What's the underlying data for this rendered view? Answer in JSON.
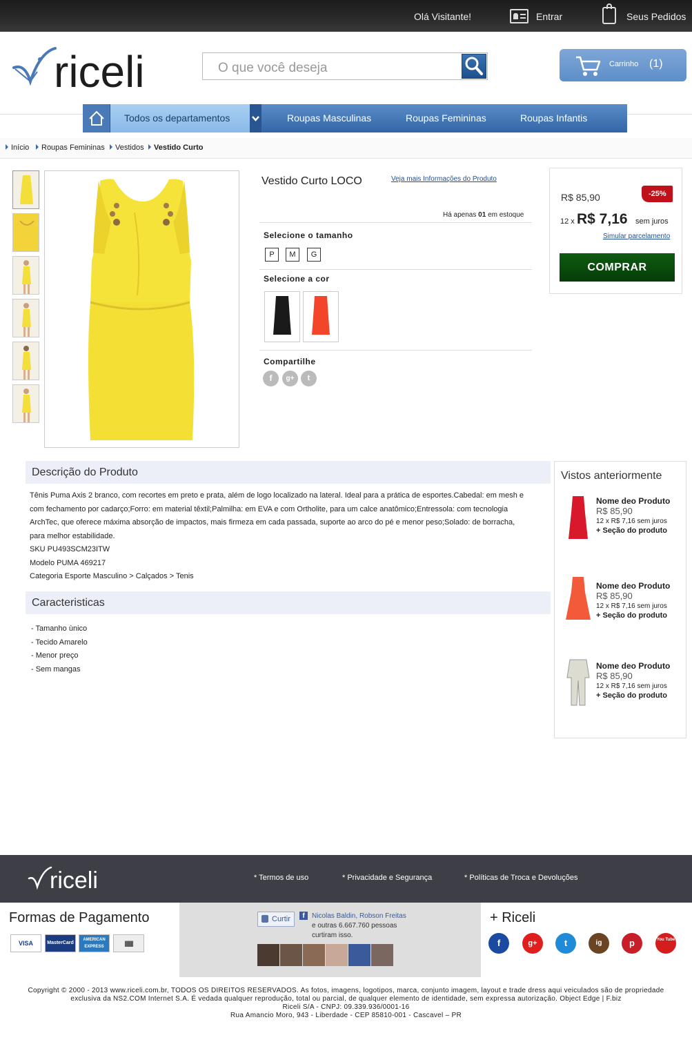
{
  "topbar": {
    "greeting": "Olá Visitante!",
    "login": "Entrar",
    "orders": "Seus Pedidos"
  },
  "header": {
    "logo": "riceli",
    "search_placeholder": "O que você deseja",
    "cart_label": "Carrinho",
    "cart_count": "(1)"
  },
  "nav": {
    "all_departments": "Todos os departamentos",
    "items": [
      "Roupas Masculinas",
      "Roupas Femininas",
      "Roupas Infantis"
    ]
  },
  "breadcrumb": [
    "Início",
    "Roupas Femininas",
    "Vestidos",
    "Vestido Curto"
  ],
  "product": {
    "title": "Vestido Curto LOCO",
    "more_info_link": "Veja mais Informações do Produto",
    "stock_prefix": "Há apenas",
    "stock_count": "01",
    "stock_suffix": "em estoque",
    "size_label": "Selecione o tamanho",
    "sizes": [
      "P",
      "M",
      "G"
    ],
    "color_label": "Selecione a cor",
    "colors": [
      "#1a1a1a",
      "#f2452a"
    ],
    "share_label": "Compartilhe",
    "share_icons": [
      "f",
      "g+",
      "t"
    ]
  },
  "pricing": {
    "old_price": "R$ 85,90",
    "discount": "-25%",
    "installments_count": "12 x",
    "installment_value": "R$ 7,16",
    "no_interest": "sem juros",
    "simulate_link": "Simular parcelamento",
    "buy_button": "COMPRAR"
  },
  "description": {
    "title": "Descrição do Produto",
    "lines": [
      "Tênis Puma Axis 2 branco, com recortes em preto e prata, além de logo localizado na lateral. Ideal para a prática de esportes.Cabedal: em mesh e",
      "com fechamento por cadarço;Forro: em material têxtil;Palmilha: em EVA e com Ortholite, para um calce anatômico;Entressola: com tecnologia",
      "ArchTec, que oferece máxima absorção de impactos, mais firmeza em cada passada, suporte ao arco do pé e menor peso;Solado: de borracha,",
      "para melhor estabilidade.",
      "SKU PU493SCM23ITW",
      "Modelo PUMA 469217",
      "Categoria Esporte Masculino > Calçados > Tenis"
    ]
  },
  "features": {
    "title": "Caracteristicas",
    "items": [
      "- Tamanho ùnico",
      "- Tecido Amarelo",
      "- Menor preço",
      "- Sem mangas"
    ]
  },
  "recently_viewed": {
    "title": "Vistos anteriormente",
    "items": [
      {
        "name": "Nome deo Produto",
        "price": "R$ 85,90",
        "installments": "12 x R$ 7,16 sem juros",
        "section": "+ Seção do produto",
        "color": "#d8192b"
      },
      {
        "name": "Nome deo Produto",
        "price": "R$ 85,90",
        "installments": "12 x R$ 7,16 sem juros",
        "section": "+ Seção do produto",
        "color": "#f25a3a"
      },
      {
        "name": "Nome deo Produto",
        "price": "R$ 85,90",
        "installments": "12 x R$ 7,16 sem juros",
        "section": "+ Seção do produto",
        "color": "#dcdcd0"
      }
    ]
  },
  "footer": {
    "logo": "riceli",
    "links": [
      "* Termos de uso",
      "* Privacidade e Segurança",
      "* Políticas de Troca e Devoluções"
    ],
    "payment_title": "Formas de Pagamento",
    "cards": [
      "VISA",
      "MasterCard",
      "AMERICAN EXPRESS",
      "||||||||"
    ],
    "facebook": {
      "like_button": "Curtir",
      "friend1": "Nicolas Baldin",
      "separator": ", ",
      "friend2": "Robson Freitas",
      "others": "e outras 6.667.760 pessoas",
      "liked": "curtiram isso."
    },
    "social_title": "+ Riceli",
    "social_icons": [
      "f",
      "g+",
      "t",
      "ig",
      "p",
      "You Tube"
    ],
    "copyright": [
      "Copyright © 2000 - 2013 www.riceli.com.br, TODOS OS DIREITOS RESERVADOS. As fotos, imagens, logotipos, marca, conjunto imagem, layout e trade dress aqui veiculados são de propriedade",
      "exclusiva da NS2.COM Internet S.A. É vedada qualquer reprodução, total ou parcial, de qualquer elemento de identidade, sem expressa autorização. Object Edge | F.biz",
      "Riceli S/A - CNPJ: 09.339.936/0001-16",
      "Rua Amancio Moro, 943 - Liberdade - CEP 85810-001 - Cascavel – PR"
    ]
  }
}
